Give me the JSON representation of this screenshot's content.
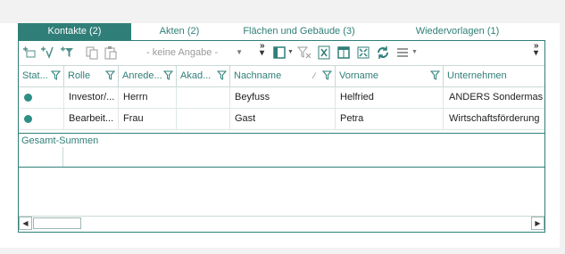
{
  "tabs": [
    {
      "label": "Kontakte (2)",
      "active": true
    },
    {
      "label": "Akten (2)",
      "active": false
    },
    {
      "label": "Flächen und Gebäude (3)",
      "active": false
    },
    {
      "label": "Wiedervorlagen (1)",
      "active": false
    }
  ],
  "toolbar": {
    "select_value": "- keine Angabe -",
    "icons": [
      "add-contact-icon",
      "check-icon",
      "filter-add-icon",
      "copy-icon",
      "paste-icon",
      "columns-icon",
      "clear-filter-icon",
      "excel-export-icon",
      "layout-icon",
      "fit-columns-icon",
      "refresh-icon",
      "menu-icon"
    ]
  },
  "grid": {
    "columns": [
      "Stat...",
      "Rolle",
      "Anrede...",
      "Akad...",
      "Nachname",
      "Vorname",
      "Unternehmen"
    ],
    "rows": [
      {
        "status_color": "#2f8f84",
        "rolle": "Investor/...",
        "anrede": "Herrn",
        "akad": "",
        "nachname": "Beyfuss",
        "vorname": "Helfried",
        "unternehmen": "ANDERS Sondermas"
      },
      {
        "status_color": "#2f8f84",
        "rolle": "Bearbeit...",
        "anrede": "Frau",
        "akad": "",
        "nachname": "Gast",
        "vorname": "Petra",
        "unternehmen": "Wirtschaftsförderung"
      }
    ],
    "summary_label": "Gesamt-Summen"
  },
  "colors": {
    "accent": "#2f7f78",
    "status": "#2f8f84"
  }
}
